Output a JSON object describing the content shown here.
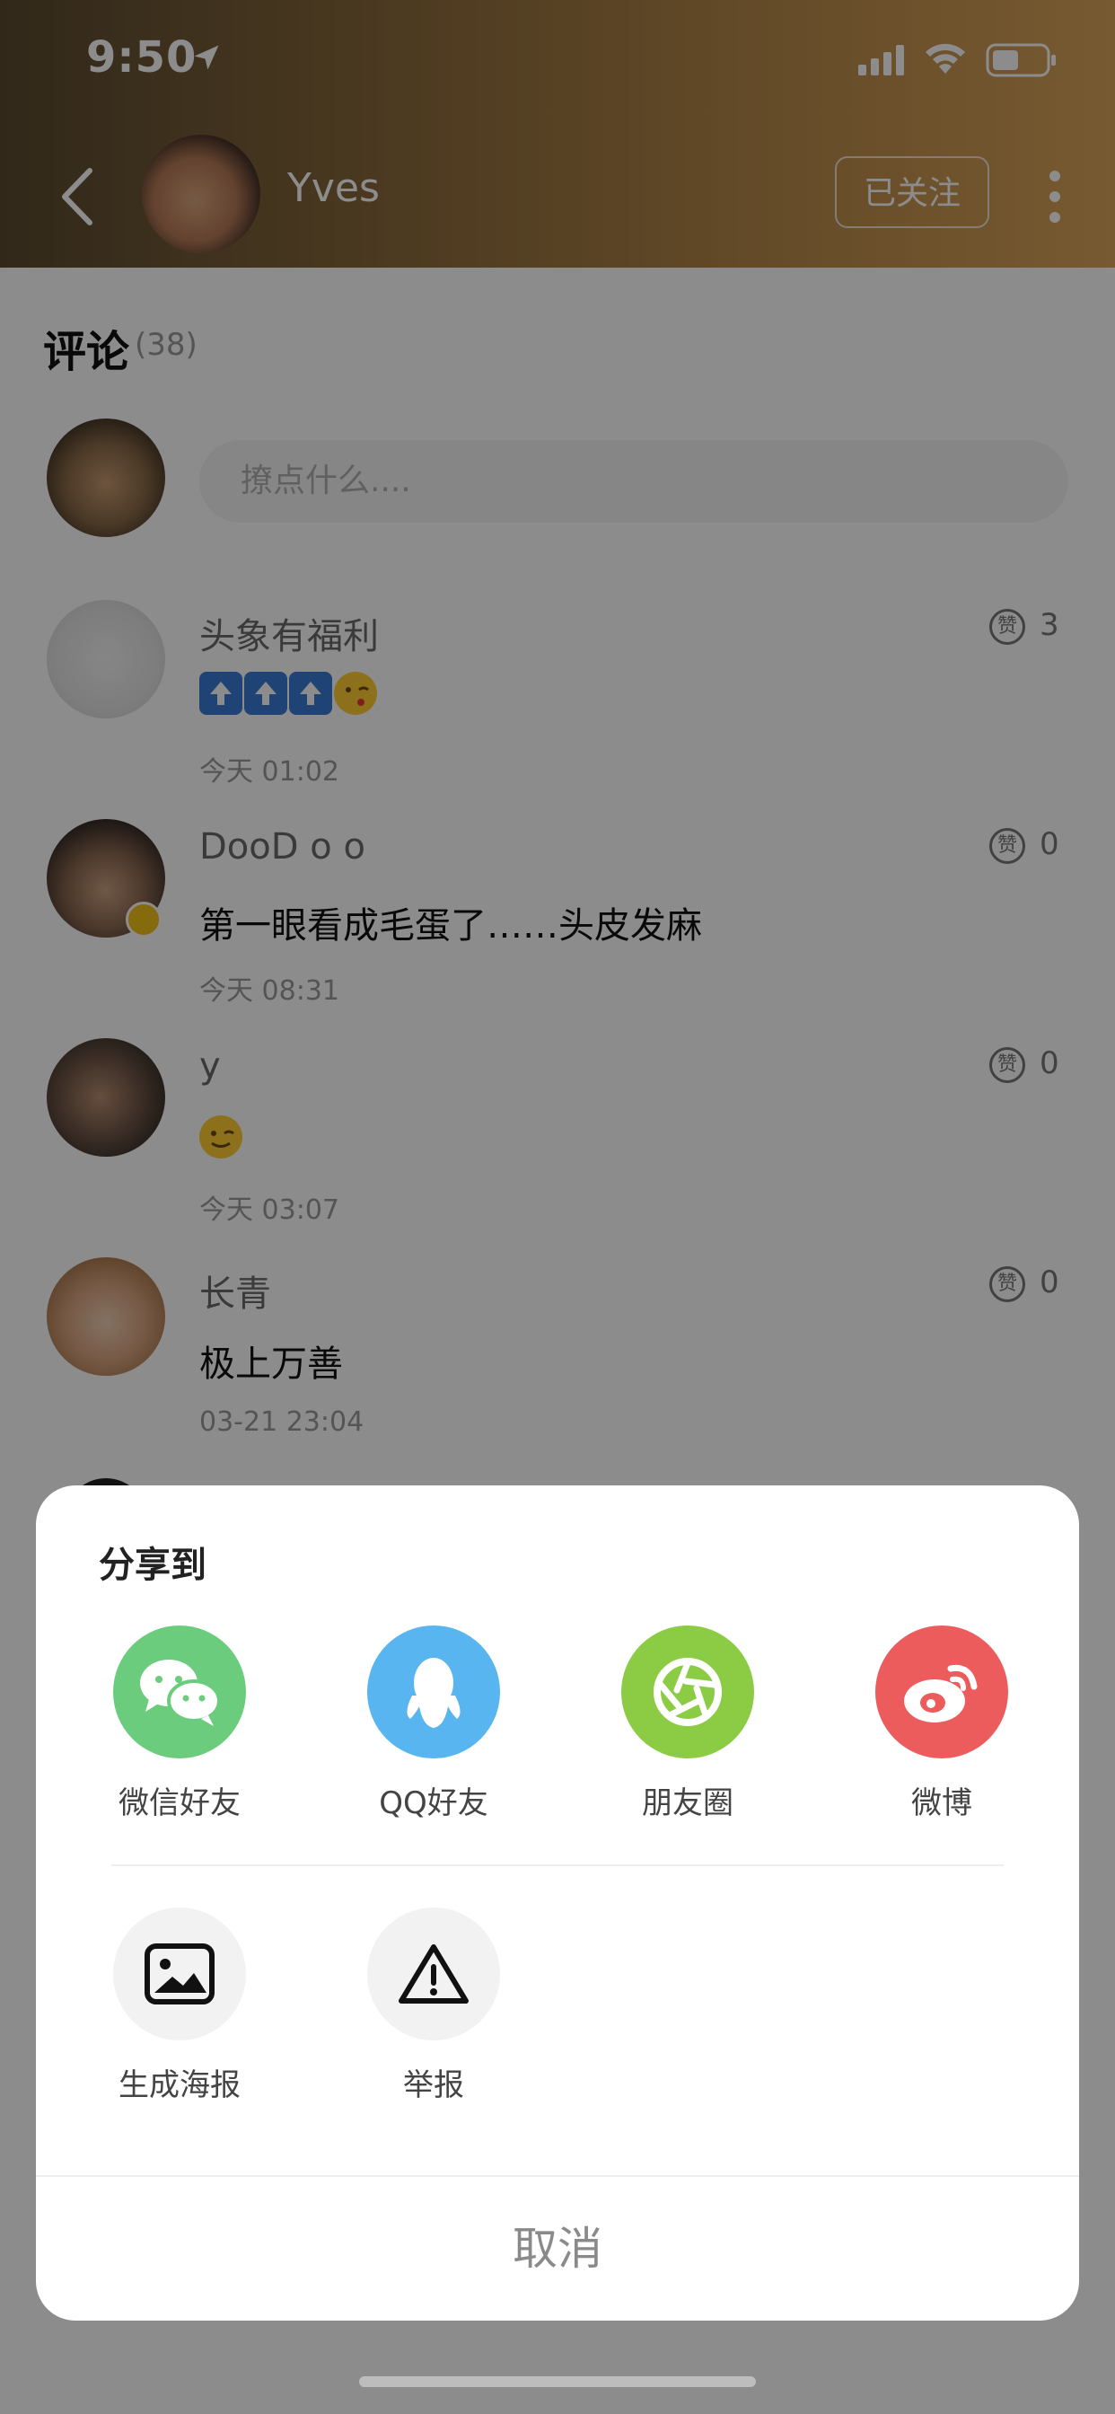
{
  "status_bar": {
    "time": "9:50"
  },
  "header": {
    "author_name": "Yves",
    "follow_label": "已关注"
  },
  "comments_section": {
    "title": "评论",
    "count": "(38)",
    "input_placeholder": "撩点什么...."
  },
  "comments": [
    {
      "name": "头象有福利",
      "text": "",
      "time": "今天 01:02",
      "likes": "3",
      "has_emoji_row": true
    },
    {
      "name": "DooD o o",
      "text": "第一眼看成毛蛋了……头皮发麻",
      "time": "今天 08:31",
      "likes": "0"
    },
    {
      "name": "y",
      "text": "",
      "time": "今天 03:07",
      "likes": "0"
    },
    {
      "name": "长青",
      "text": "极上万善",
      "time": "03-21 23:04",
      "likes": "0"
    }
  ],
  "like_label": "赞",
  "share_sheet": {
    "title": "分享到",
    "items": [
      {
        "label": "微信好友",
        "icon": "wechat-icon",
        "color": "#6ccc7e"
      },
      {
        "label": "QQ好友",
        "icon": "qq-icon",
        "color": "#58b5ef"
      },
      {
        "label": "朋友圈",
        "icon": "moments-icon",
        "color": "#8ccc45"
      },
      {
        "label": "微博",
        "icon": "weibo-icon",
        "color": "#ec5c5c"
      },
      {
        "label": "生成海报",
        "icon": "image-icon",
        "color": "#f2f2f2"
      },
      {
        "label": "举报",
        "icon": "warning-icon",
        "color": "#f2f2f2"
      }
    ],
    "cancel_label": "取消"
  }
}
